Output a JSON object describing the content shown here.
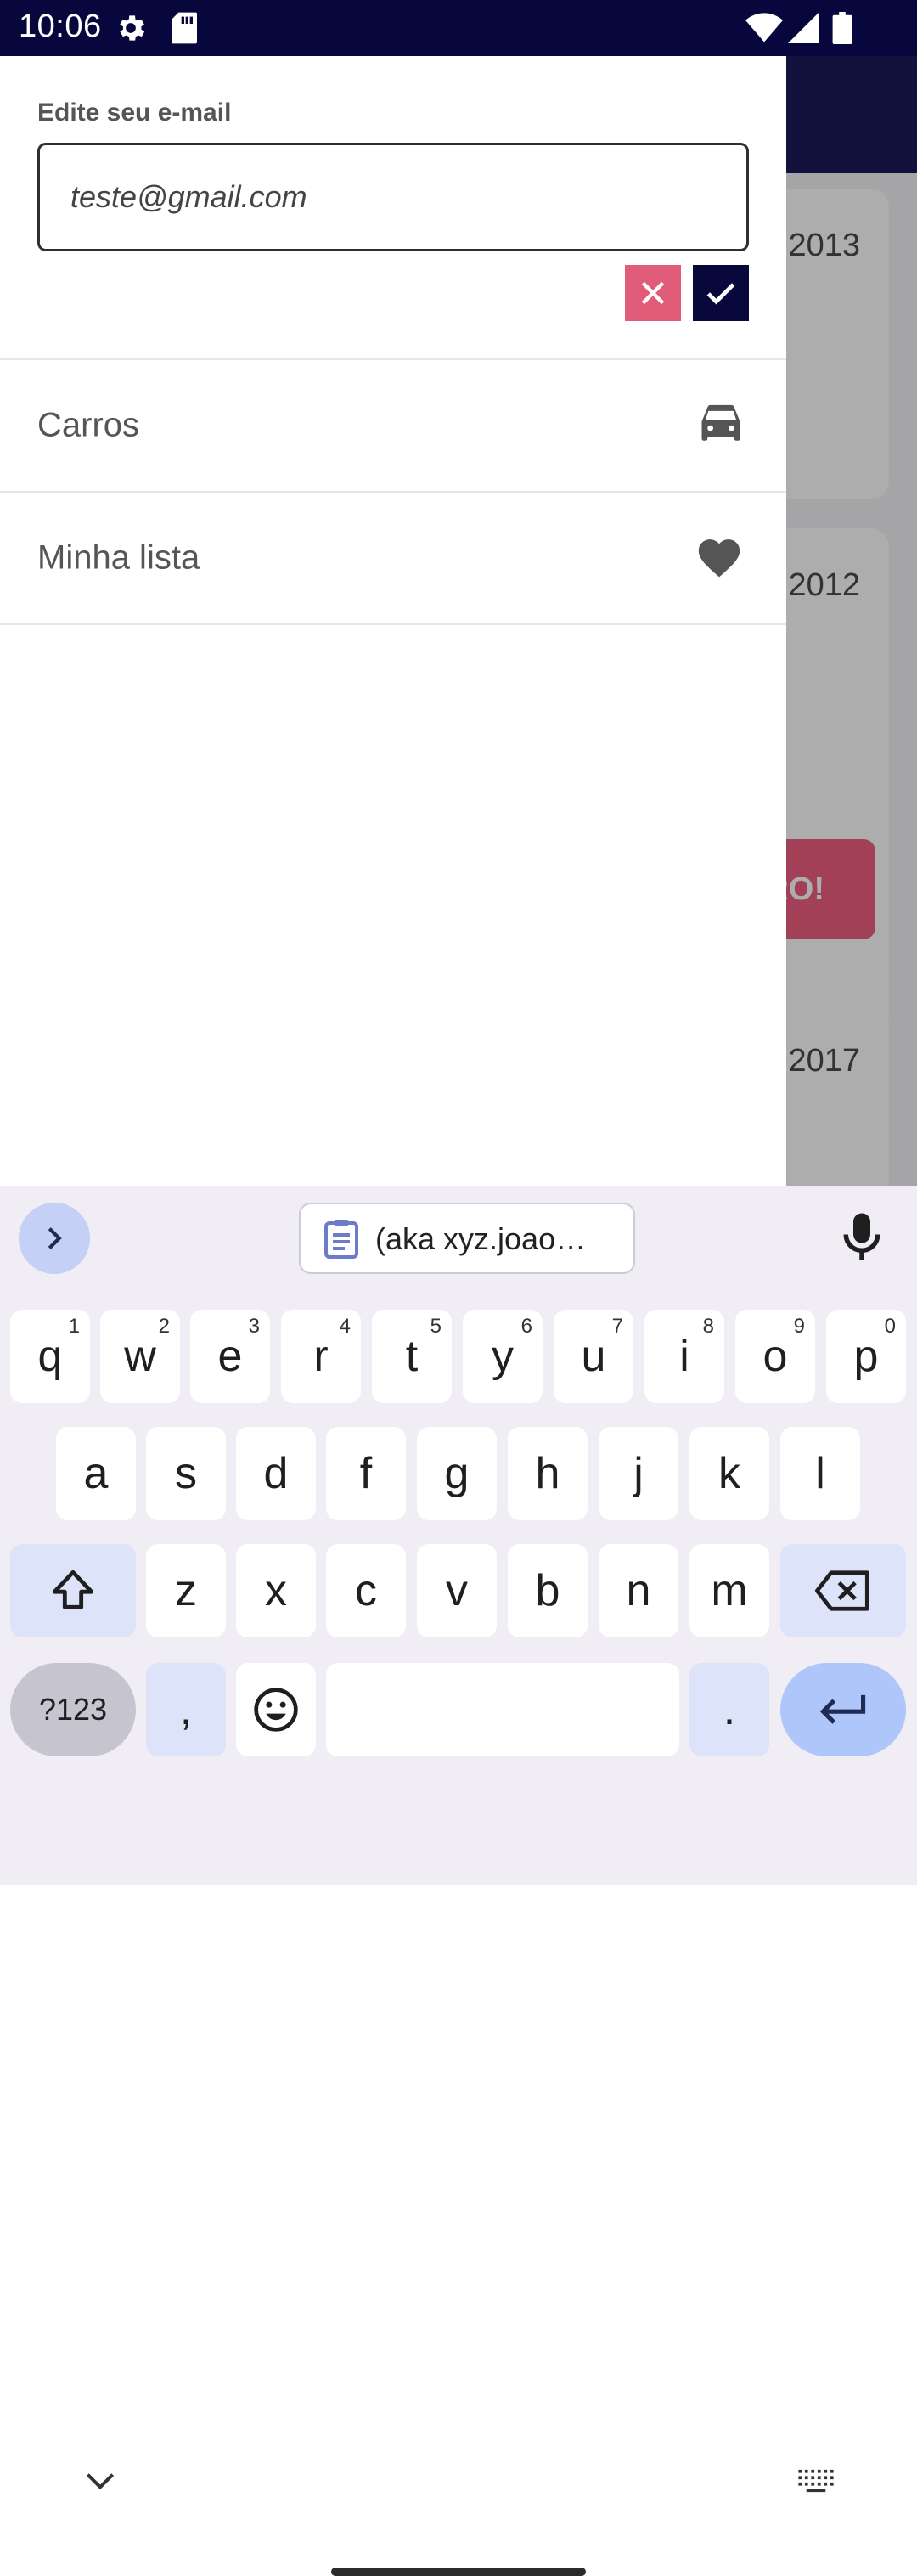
{
  "status_bar": {
    "time": "10:06"
  },
  "background": {
    "cards": [
      {
        "year": "2013"
      },
      {
        "year": "2012",
        "button_label": "RO!"
      },
      {
        "year": "2017"
      }
    ]
  },
  "drawer": {
    "edit_label": "Edite seu e-mail",
    "email_value": "teste@gmail.com",
    "menu": [
      {
        "label": "Carros",
        "icon": "car-icon"
      },
      {
        "label": "Minha lista",
        "icon": "heart-icon"
      }
    ]
  },
  "keyboard": {
    "clipboard_text": "(aka xyz.joao…",
    "row1": [
      {
        "char": "q",
        "sup": "1"
      },
      {
        "char": "w",
        "sup": "2"
      },
      {
        "char": "e",
        "sup": "3"
      },
      {
        "char": "r",
        "sup": "4"
      },
      {
        "char": "t",
        "sup": "5"
      },
      {
        "char": "y",
        "sup": "6"
      },
      {
        "char": "u",
        "sup": "7"
      },
      {
        "char": "i",
        "sup": "8"
      },
      {
        "char": "o",
        "sup": "9"
      },
      {
        "char": "p",
        "sup": "0"
      }
    ],
    "row2": [
      "a",
      "s",
      "d",
      "f",
      "g",
      "h",
      "j",
      "k",
      "l"
    ],
    "row3": [
      "z",
      "x",
      "c",
      "v",
      "b",
      "n",
      "m"
    ],
    "symbols_label": "?123",
    "comma": ",",
    "period": "."
  },
  "colors": {
    "status_bar_bg": "#07063d",
    "cancel_button": "#e15c78",
    "confirm_button": "#09083d",
    "enter_key": "#afc6fb"
  }
}
